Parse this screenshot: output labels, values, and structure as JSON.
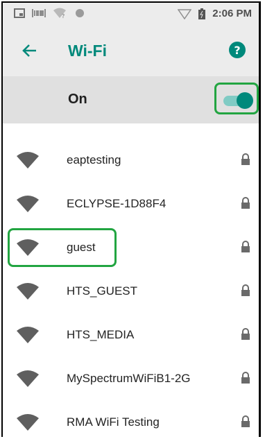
{
  "status_bar": {
    "time": "2:06 PM",
    "icons": [
      "screenshot-icon",
      "barcode-icon",
      "wifi-question-icon",
      "circle-icon",
      "signal-icon",
      "battery-icon"
    ]
  },
  "toolbar": {
    "title": "Wi-Fi",
    "back_icon": "arrow-back-icon",
    "help_icon": "help-icon"
  },
  "wifi_toggle": {
    "label": "On",
    "state": "on"
  },
  "networks": [
    {
      "ssid": "eaptesting",
      "secured": true
    },
    {
      "ssid": "ECLYPSE-1D88F4",
      "secured": true
    },
    {
      "ssid": "guest",
      "secured": true
    },
    {
      "ssid": "HTS_GUEST",
      "secured": true
    },
    {
      "ssid": "HTS_MEDIA",
      "secured": true
    },
    {
      "ssid": "MySpectrumWiFiB1-2G",
      "secured": true
    },
    {
      "ssid": "RMA WiFi Testing",
      "secured": true
    }
  ],
  "colors": {
    "accent": "#00897b",
    "highlight": "#22a541"
  }
}
